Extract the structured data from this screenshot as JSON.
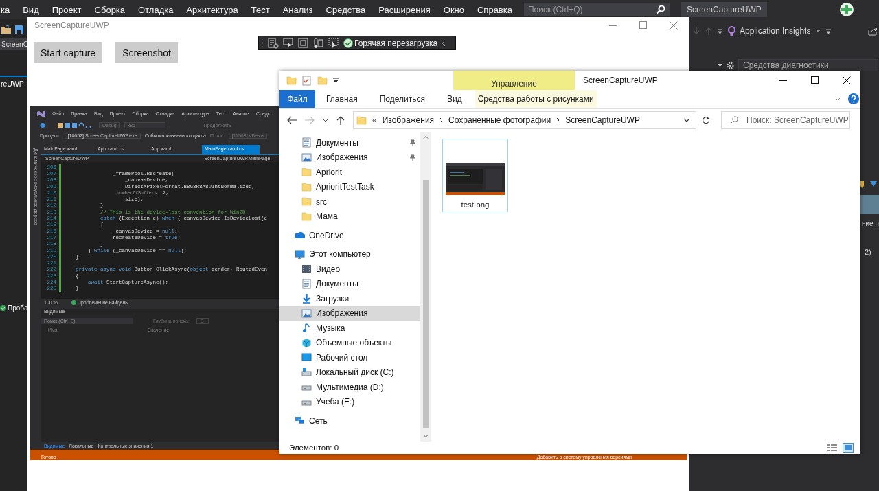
{
  "ide": {
    "menu": [
      "ка",
      "Вид",
      "Проект",
      "Сборка",
      "Отладка",
      "Архитектура",
      "Тест",
      "Анализ",
      "Средства",
      "Расширения",
      "Окно",
      "Справка"
    ],
    "search": {
      "placeholder": "Поиск (Ctrl+Q)"
    },
    "solution_name": "ScreenCaptureUWP",
    "left_strip": {
      "tab_fragment": "ScreenC",
      "doc_tab": "reUWP",
      "error_list": "Пробл"
    },
    "right_panel": {
      "app_insights": "Application Insights",
      "diagnostics": "Средства диагностики",
      "fragments": [
        "ние п",
        "2)"
      ]
    }
  },
  "app_window": {
    "title": "ScreenCaptureUWP",
    "buttons": [
      "Start capture",
      "Screenshot"
    ],
    "debug_toolbar": {
      "hot_reload": "Горячая перезагрузка"
    },
    "captured_ide": {
      "menu": [
        "Файл",
        "Правка",
        "Вид",
        "Проект",
        "Сборка",
        "Отладка",
        "Архитектура",
        "Тест",
        "Анализ",
        "Средс"
      ],
      "toolbar": {
        "configuration": "Debug",
        "platform": "x86",
        "continue": "Продолжить"
      },
      "process_label": "Процесс:",
      "process": "[10652] ScreenCaptureUWP.exe",
      "lifecycle": "События жизненного цикла",
      "thread_label": "Поток:",
      "thread": "[11508] <Без и",
      "side_label": "Динамическое визуальное дерево",
      "tabs": [
        {
          "label": "MainPage.xaml",
          "selected": false
        },
        {
          "label": "App.xaml.cs",
          "selected": false
        },
        {
          "label": "App.xaml",
          "selected": false
        },
        {
          "label": "MainPage.xaml.cs",
          "selected": true
        }
      ],
      "nav": {
        "project": "ScreenCaptureUWP",
        "type": "ScreenCaptureUWP.MainPage"
      },
      "code_lines": [
        {
          "num": "206"
        },
        {
          "num": "207",
          "segments": [
            {
              "text": "                _framePool.Recreate(",
              "kind": "plain"
            }
          ]
        },
        {
          "num": "208",
          "segments": [
            {
              "text": "                    _canvasDevice,",
              "kind": "plain"
            }
          ]
        },
        {
          "num": "209",
          "segments": [
            {
              "text": "                    DirectXPixelFormat.B8G8R8A8UIntNormalized,",
              "kind": "plain"
            }
          ]
        },
        {
          "num": "210",
          "segments": [
            {
              "text": "                    numberOfBuffers:",
              "kind": "hint"
            },
            {
              "text": " 2,",
              "kind": "plain"
            }
          ]
        },
        {
          "num": "211",
          "segments": [
            {
              "text": "                    size);",
              "kind": "plain"
            }
          ]
        },
        {
          "num": "212",
          "segments": [
            {
              "text": "            }",
              "kind": "plain"
            }
          ]
        },
        {
          "num": "213",
          "segments": [
            {
              "text": "            // This is the device-lost convention for Win2D.",
              "kind": "comment"
            }
          ]
        },
        {
          "num": "214",
          "segments": [
            {
              "text": "            catch",
              "kind": "keyword"
            },
            {
              "text": " (Exception e) ",
              "kind": "plain"
            },
            {
              "text": "when",
              "kind": "keyword"
            },
            {
              "text": " (_canvasDevice.IsDeviceLost(e",
              "kind": "plain"
            }
          ]
        },
        {
          "num": "215",
          "segments": [
            {
              "text": "            {",
              "kind": "plain"
            }
          ]
        },
        {
          "num": "216",
          "segments": [
            {
              "text": "                _canvasDevice = ",
              "kind": "plain"
            },
            {
              "text": "null",
              "kind": "keyword"
            },
            {
              "text": ";",
              "kind": "plain"
            }
          ]
        },
        {
          "num": "217",
          "segments": [
            {
              "text": "                recreateDevice = ",
              "kind": "plain"
            },
            {
              "text": "true",
              "kind": "keyword"
            },
            {
              "text": ";",
              "kind": "plain"
            }
          ]
        },
        {
          "num": "218",
          "segments": [
            {
              "text": "            }",
              "kind": "plain"
            }
          ]
        },
        {
          "num": "219",
          "segments": [
            {
              "text": "        } ",
              "kind": "plain"
            },
            {
              "text": "while",
              "kind": "keyword"
            },
            {
              "text": " (_canvasDevice == ",
              "kind": "plain"
            },
            {
              "text": "null",
              "kind": "keyword"
            },
            {
              "text": ");",
              "kind": "plain"
            }
          ]
        },
        {
          "num": "220",
          "segments": [
            {
              "text": "    }",
              "kind": "plain"
            }
          ]
        },
        {
          "num": "221"
        },
        {
          "num": "222",
          "segments": [
            {
              "text": "    private async void",
              "kind": "keyword"
            },
            {
              "text": " Button_ClickAsync(",
              "kind": "plain"
            },
            {
              "text": "object",
              "kind": "keyword"
            },
            {
              "text": " sender, RoutedEven",
              "kind": "plain"
            }
          ]
        },
        {
          "num": "223",
          "segments": [
            {
              "text": "    {",
              "kind": "plain"
            }
          ]
        },
        {
          "num": "224",
          "segments": [
            {
              "text": "        await",
              "kind": "keyword"
            },
            {
              "text": " StartCaptureAsync();",
              "kind": "plain"
            }
          ]
        },
        {
          "num": "225",
          "segments": [
            {
              "text": "    }",
              "kind": "plain"
            }
          ]
        }
      ],
      "zoom": "100 %",
      "problems": "Проблемы не найдены.",
      "panel": {
        "title": "Видимые",
        "search_placeholder": "Поиск (Ctrl+E)",
        "depth_label": "Глубина поиска:",
        "depth": "3",
        "columns": [
          "Имя",
          "Значение"
        ],
        "tabs": [
          {
            "label": "Видимые",
            "selected": true
          },
          {
            "label": "Локальные",
            "selected": false
          },
          {
            "label": "Контрольные значения 1",
            "selected": false
          }
        ]
      },
      "status": "Готово",
      "source_control": "Добавить в систему управления версиями"
    }
  },
  "explorer": {
    "title": "ScreenCaptureUWP",
    "context_group": "Управление",
    "ribbon_tabs": [
      {
        "label": "Файл",
        "kind": "file"
      },
      {
        "label": "Главная",
        "kind": "normal"
      },
      {
        "label": "Поделиться",
        "kind": "normal"
      },
      {
        "label": "Вид",
        "kind": "normal"
      },
      {
        "label": "Средства работы с рисунками",
        "kind": "context"
      }
    ],
    "breadcrumbs": [
      "Изображения",
      "Сохраненные фотографии",
      "ScreenCaptureUWP"
    ],
    "overflow": "«",
    "search": {
      "placeholder": "Поиск: ScreenCaptureUWP"
    },
    "quick_access": [
      {
        "label": "Документы",
        "kind": "docs",
        "pinned": true,
        "selected": false
      },
      {
        "label": "Изображения",
        "kind": "pictures",
        "pinned": true,
        "selected": false
      },
      {
        "label": "Apriorit",
        "kind": "folder",
        "pinned": false,
        "selected": false
      },
      {
        "label": "AprioritTestTask",
        "kind": "folder",
        "pinned": false,
        "selected": false
      },
      {
        "label": "src",
        "kind": "folder",
        "pinned": false,
        "selected": false
      },
      {
        "label": "Мама",
        "kind": "folder",
        "pinned": false,
        "selected": false
      }
    ],
    "tree": [
      {
        "label": "OneDrive",
        "kind": "onedrive",
        "selected": false
      },
      {
        "label": "Этот компьютер",
        "kind": "computer",
        "selected": false,
        "children": [
          {
            "label": "Видео",
            "kind": "video",
            "selected": false
          },
          {
            "label": "Документы",
            "kind": "docs",
            "selected": false
          },
          {
            "label": "Загрузки",
            "kind": "download",
            "selected": false
          },
          {
            "label": "Изображения",
            "kind": "pictures",
            "selected": true
          },
          {
            "label": "Музыка",
            "kind": "music",
            "selected": false
          },
          {
            "label": "Объемные объекты",
            "kind": "objects3d",
            "selected": false
          },
          {
            "label": "Рабочий стол",
            "kind": "desktop",
            "selected": false
          },
          {
            "label": "Локальный диск (C:)",
            "kind": "drive_system",
            "selected": false
          },
          {
            "label": "Мультимедиа (D:)",
            "kind": "drive",
            "selected": false
          },
          {
            "label": "Учеба (E:)",
            "kind": "drive",
            "selected": false
          }
        ]
      },
      {
        "label": "Сеть",
        "kind": "network",
        "selected": false
      }
    ],
    "files": [
      {
        "name": "test.png",
        "selected": true
      }
    ],
    "status": "Элементов: 0"
  }
}
